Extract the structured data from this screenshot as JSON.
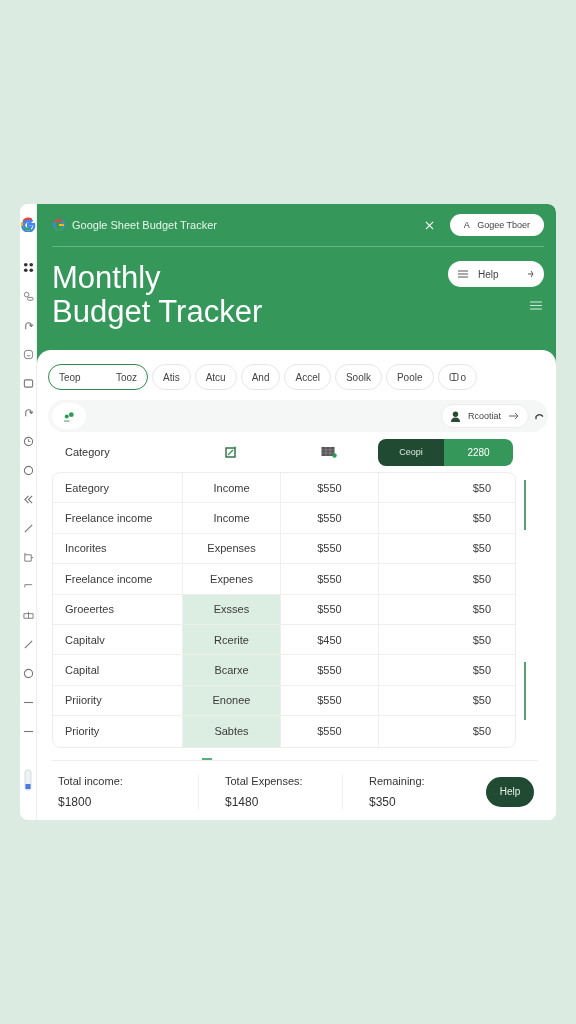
{
  "header": {
    "app_title": "Google Sheet Budget Tracker",
    "account_button": {
      "icon": "A",
      "label": "Gogee Tboer"
    },
    "title_lines": [
      "Monthly",
      "Budget Tracker"
    ],
    "help_button": "Help"
  },
  "chips": [
    {
      "label": "Teop",
      "extra": "Tooz",
      "selected": true
    },
    {
      "label": "Atis",
      "selected": false
    },
    {
      "label": "Atcu",
      "selected": false
    },
    {
      "label": "And",
      "selected": false
    },
    {
      "label": "Accel",
      "selected": false
    },
    {
      "label": "Soolk",
      "selected": false
    },
    {
      "label": "Poole",
      "selected": false
    },
    {
      "label": "o",
      "selected": false
    }
  ],
  "toolbar": {
    "report_button": "Rcootiat"
  },
  "table": {
    "column_1": "Category",
    "segment": [
      "Ceopi",
      "2280"
    ],
    "rows": [
      {
        "category": "Eategory",
        "type": "Income",
        "amount": "$550",
        "column_4": "$50",
        "highlighted": false
      },
      {
        "category": "Freelance income",
        "type": "Income",
        "amount": "$550",
        "column_4": "$50",
        "highlighted": false
      },
      {
        "category": "Incorites",
        "type": "Expenses",
        "amount": "$550",
        "column_4": "$50",
        "highlighted": false
      },
      {
        "category": "Freelance income",
        "type": "Expenes",
        "amount": "$550",
        "column_4": "$50",
        "highlighted": false
      },
      {
        "category": "Groeertes",
        "type": "Exsses",
        "amount": "$550",
        "column_4": "$50",
        "highlighted": true
      },
      {
        "category": "Capitalv",
        "type": "Rcerite",
        "amount": "$450",
        "column_4": "$50",
        "highlighted": true
      },
      {
        "category": "Capital",
        "type": "Bcarxe",
        "amount": "$550",
        "column_4": "$50",
        "highlighted": true
      },
      {
        "category": "Priiority",
        "type": "Enonee",
        "amount": "$550",
        "column_4": "$50",
        "highlighted": true
      },
      {
        "category": "Priority",
        "type": "Sabtes",
        "amount": "$550",
        "column_4": "$50",
        "highlighted": true
      }
    ]
  },
  "totals": [
    {
      "label": "Total income:",
      "value": "$1800"
    },
    {
      "label": "Total Expenses:",
      "value": "$1480"
    },
    {
      "label": "Remaining:",
      "value": "$350"
    }
  ],
  "footer_button": "Help"
}
